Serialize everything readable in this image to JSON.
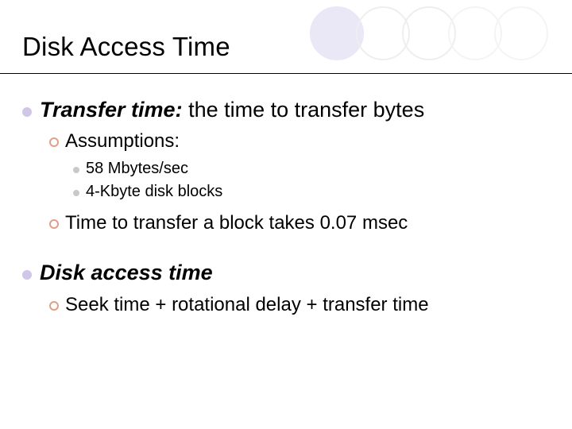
{
  "title": "Disk Access Time",
  "sections": [
    {
      "head_bold": "Transfer time:",
      "head_rest": "  the time to transfer bytes",
      "subs": [
        {
          "text": "Assumptions:",
          "items": [
            "58 Mbytes/sec",
            "4-Kbyte disk blocks"
          ]
        },
        {
          "text": "Time to transfer a block takes 0.07 msec",
          "items": []
        }
      ]
    },
    {
      "head_bold": "Disk access time",
      "head_rest": "",
      "subs": [
        {
          "text": "Seek time + rotational delay + transfer time",
          "items": []
        }
      ]
    }
  ]
}
